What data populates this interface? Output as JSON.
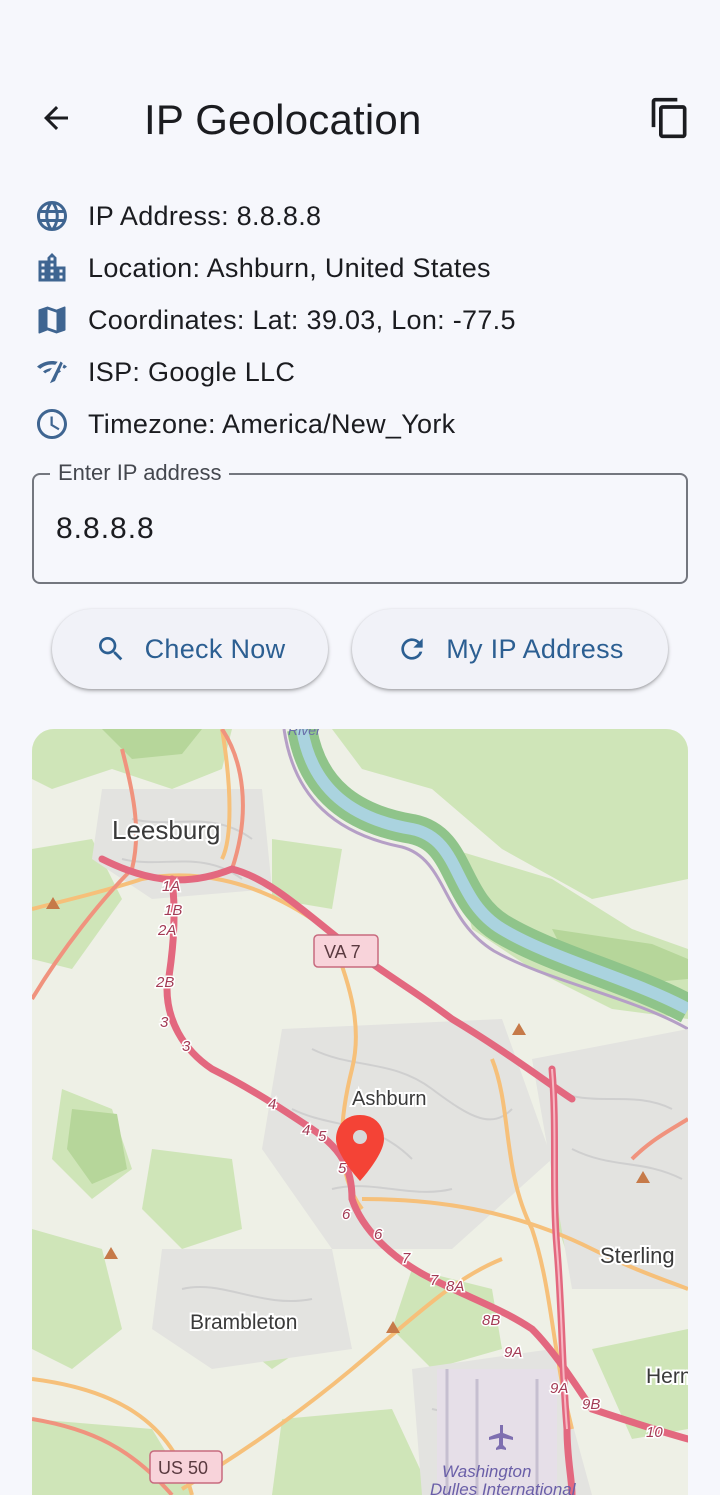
{
  "appbar": {
    "title": "IP Geolocation",
    "back_icon": "arrow-back-icon",
    "copy_icon": "copy-icon"
  },
  "info": [
    {
      "icon": "globe-icon",
      "text": "IP Address: 8.8.8.8"
    },
    {
      "icon": "building-icon",
      "text": "Location: Ashburn, United States"
    },
    {
      "icon": "map-icon",
      "text": "Coordinates: Lat: 39.03, Lon: -77.5"
    },
    {
      "icon": "wifi-icon",
      "text": "ISP: Google LLC"
    },
    {
      "icon": "clock-icon",
      "text": "Timezone: America/New_York"
    }
  ],
  "ip_field": {
    "label": "Enter IP address",
    "value": "8.8.8.8"
  },
  "buttons": {
    "check_label": "Check Now",
    "myip_label": "My IP Address"
  },
  "map": {
    "labels": {
      "river": "River",
      "leesburg": "Leesburg",
      "va7": "VA 7",
      "ashburn": "Ashburn",
      "sterling": "Sterling",
      "brambleton": "Brambleton",
      "us50": "US 50",
      "herndon": "Hern",
      "washington": "Washington",
      "dulles": "Dulles International"
    },
    "exits": [
      "1A",
      "1B",
      "2A",
      "2B",
      "3",
      "3",
      "4",
      "4",
      "5",
      "5",
      "6",
      "6",
      "7",
      "7",
      "8A",
      "8B",
      "9A",
      "9A",
      "9B",
      "10"
    ]
  },
  "colors": {
    "accent": "#2c5f92",
    "icon": "#3f6591",
    "marker": "#f44336",
    "highway": "#e57e93",
    "primary_road": "#f6c07a",
    "river": "#aad3df"
  }
}
